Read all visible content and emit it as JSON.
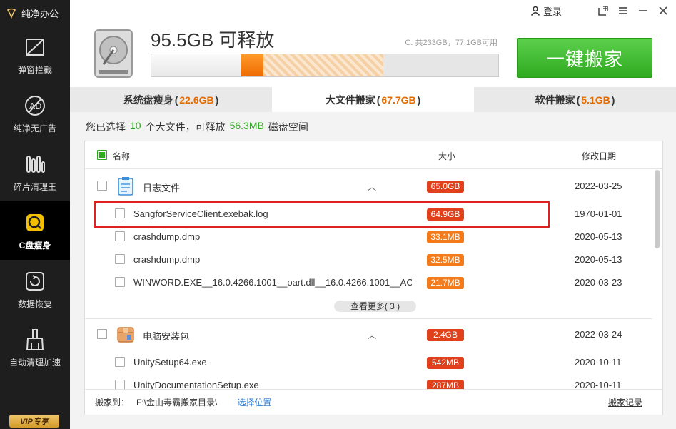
{
  "app": {
    "brand": "纯净办公"
  },
  "sidebar": {
    "items": [
      {
        "label": "弹窗拦截",
        "icon": "popup-block-icon"
      },
      {
        "label": "纯净无广告",
        "icon": "ad-block-icon"
      },
      {
        "label": "碎片清理王",
        "icon": "fragment-clean-icon"
      },
      {
        "label": "C盘瘦身",
        "icon": "disk-slim-icon",
        "active": true
      },
      {
        "label": "数据恢复",
        "icon": "data-recovery-icon"
      },
      {
        "label": "自动清理加速",
        "icon": "auto-clean-icon"
      }
    ],
    "vip": "VIP专享"
  },
  "topbar": {
    "login": "登录",
    "buttons": [
      "skin-icon",
      "menu-icon",
      "minimize-icon",
      "close-icon"
    ]
  },
  "header": {
    "freeable": "95.5GB 可释放",
    "disk_info": "C: 共233GB，77.1GB可用",
    "usage": {
      "used_fraction": 0.26,
      "selected_fraction": 0.064,
      "available_fraction": 0.344
    },
    "move_button": "一键搬家"
  },
  "tabs": [
    {
      "label": "系统盘瘦身",
      "count": "22.6GB",
      "active": false
    },
    {
      "label": "大文件搬家",
      "count": "67.7GB",
      "active": true
    },
    {
      "label": "软件搬家",
      "count": "5.1GB",
      "active": false
    }
  ],
  "summary": {
    "prefix": "您已选择",
    "count": "10",
    "middle": "个大文件，可释放",
    "size": "56.3MB",
    "suffix": "磁盘空间"
  },
  "list": {
    "headers": {
      "name": "名称",
      "size": "大小",
      "date": "修改日期"
    },
    "groups": [
      {
        "name": "日志文件",
        "size": "65.0GB",
        "date": "2022-03-25",
        "files": [
          {
            "name": "SangforServiceClient.exebak.log",
            "size": "64.9GB",
            "date": "1970-01-01"
          },
          {
            "name": "crashdump.dmp",
            "size": "33.1MB",
            "date": "2020-05-13"
          },
          {
            "name": "crashdump.dmp",
            "size": "32.5MB",
            "date": "2020-05-13"
          },
          {
            "name": "WINWORD.EXE__16.0.4266.1001__oart.dll__16.0.4266.1001__AC...",
            "size": "21.7MB",
            "date": "2020-03-23"
          }
        ],
        "see_more": "查看更多( 3 )"
      },
      {
        "name": "电脑安装包",
        "size": "2.4GB",
        "date": "2022-03-24",
        "files": [
          {
            "name": "UnitySetup64.exe",
            "size": "542MB",
            "date": "2020-10-11"
          },
          {
            "name": "UnityDocumentationSetup.exe",
            "size": "287MB",
            "date": "2020-10-11"
          }
        ]
      }
    ]
  },
  "footer": {
    "move_to_label": "搬家到：",
    "path": "F:\\金山毒霸搬家目录\\",
    "choose": "选择位置",
    "record": "搬家记录"
  }
}
